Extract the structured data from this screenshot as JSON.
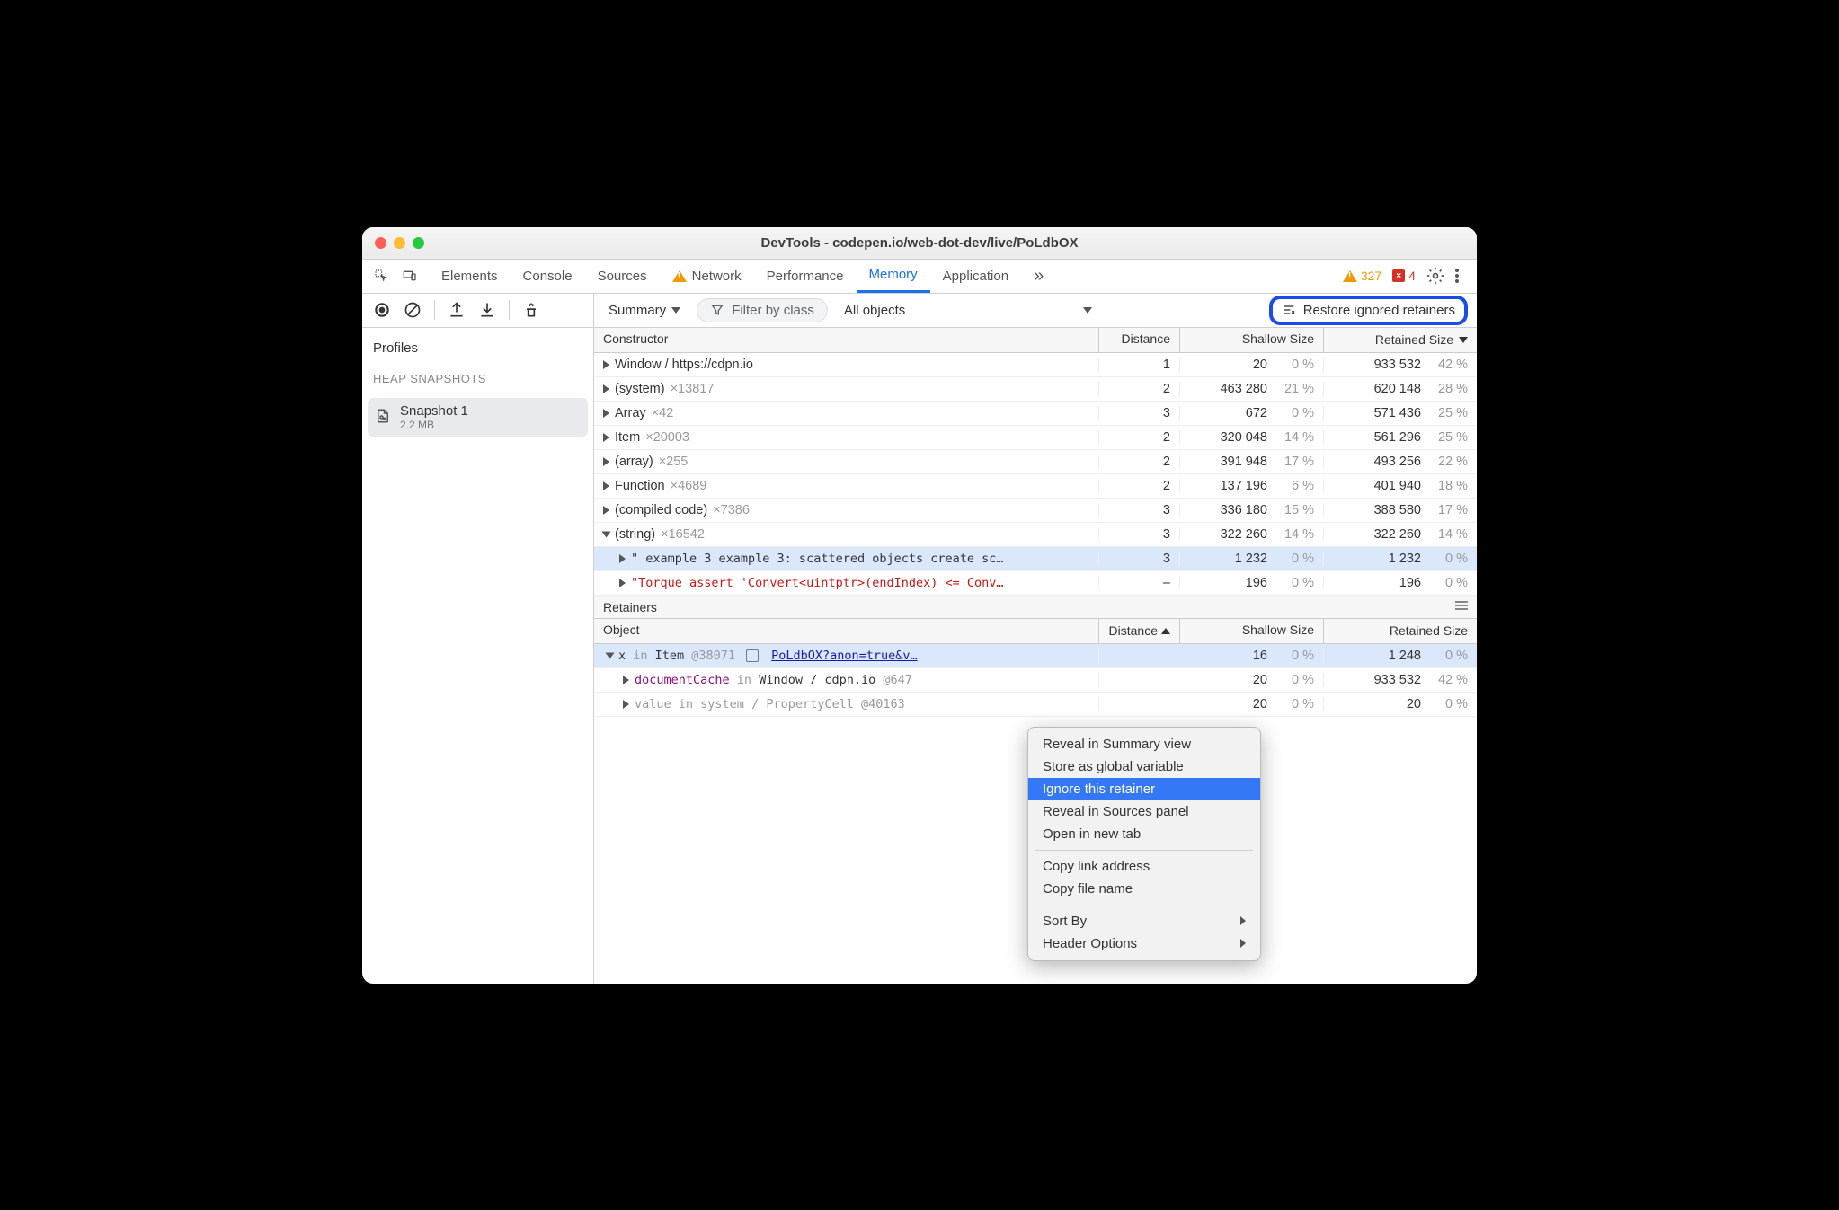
{
  "window": {
    "title": "DevTools - codepen.io/web-dot-dev/live/PoLdbOX"
  },
  "tabs": {
    "items": [
      "Elements",
      "Console",
      "Sources",
      "Network",
      "Performance",
      "Memory",
      "Application"
    ],
    "active": "Memory",
    "warn_count": "327",
    "err_count": "4"
  },
  "toolbar": {
    "summary": "Summary",
    "filter_placeholder": "Filter by class",
    "all_objects": "All objects",
    "restore": "Restore ignored retainers"
  },
  "sidebar": {
    "profiles": "Profiles",
    "section": "HEAP SNAPSHOTS",
    "snapshot": {
      "name": "Snapshot 1",
      "size": "2.2 MB"
    }
  },
  "headers": {
    "constructor": "Constructor",
    "distance": "Distance",
    "shallow": "Shallow Size",
    "retained": "Retained Size"
  },
  "rows": [
    {
      "c": "Window / https://cdpn.io",
      "x": "",
      "d": "1",
      "sv": "20",
      "sp": "0 %",
      "rv": "933 532",
      "rp": "42 %",
      "open": false,
      "indent": 0
    },
    {
      "c": "(system)",
      "x": "×13817",
      "d": "2",
      "sv": "463 280",
      "sp": "21 %",
      "rv": "620 148",
      "rp": "28 %",
      "open": false,
      "indent": 0
    },
    {
      "c": "Array",
      "x": "×42",
      "d": "3",
      "sv": "672",
      "sp": "0 %",
      "rv": "571 436",
      "rp": "25 %",
      "open": false,
      "indent": 0
    },
    {
      "c": "Item",
      "x": "×20003",
      "d": "2",
      "sv": "320 048",
      "sp": "14 %",
      "rv": "561 296",
      "rp": "25 %",
      "open": false,
      "indent": 0
    },
    {
      "c": "(array)",
      "x": "×255",
      "d": "2",
      "sv": "391 948",
      "sp": "17 %",
      "rv": "493 256",
      "rp": "22 %",
      "open": false,
      "indent": 0
    },
    {
      "c": "Function",
      "x": "×4689",
      "d": "2",
      "sv": "137 196",
      "sp": "6 %",
      "rv": "401 940",
      "rp": "18 %",
      "open": false,
      "indent": 0
    },
    {
      "c": "(compiled code)",
      "x": "×7386",
      "d": "3",
      "sv": "336 180",
      "sp": "15 %",
      "rv": "388 580",
      "rp": "17 %",
      "open": false,
      "indent": 0
    },
    {
      "c": "(string)",
      "x": "×16542",
      "d": "3",
      "sv": "322 260",
      "sp": "14 %",
      "rv": "322 260",
      "rp": "14 %",
      "open": true,
      "indent": 0
    },
    {
      "c": "\" example 3 example 3: scattered objects create sc…",
      "x": "",
      "d": "3",
      "sv": "1 232",
      "sp": "0 %",
      "rv": "1 232",
      "rp": "0 %",
      "open": false,
      "indent": 1,
      "mono": true,
      "sel": true
    },
    {
      "c": "\"Torque assert 'Convert<uintptr>(endIndex) <= Conv…",
      "x": "",
      "d": "–",
      "sv": "196",
      "sp": "0 %",
      "rv": "196",
      "rp": "0 %",
      "open": false,
      "indent": 1,
      "mono": true,
      "red": true
    }
  ],
  "retainers": {
    "label": "Retainers",
    "headers": {
      "object": "Object",
      "distance": "Distance",
      "shallow": "Shallow Size",
      "retained": "Retained Size"
    },
    "rows": [
      {
        "html": "x|in|Item|@38071",
        "link": "PoLdbOX?anon=true&v…",
        "d": "",
        "sv": "16",
        "sp": "0 %",
        "rv": "1 248",
        "rp": "0 %",
        "open": true,
        "sel": true,
        "indent": 0
      },
      {
        "html": "documentCache|in|Window / cdpn.io|@647",
        "d": "",
        "sv": "20",
        "sp": "0 %",
        "rv": "933 532",
        "rp": "42 %",
        "open": false,
        "indent": 1,
        "purple": true
      },
      {
        "html": "value|in|system / PropertyCell|@40163",
        "d": "",
        "sv": "20",
        "sp": "0 %",
        "rv": "20",
        "rp": "0 %",
        "open": false,
        "indent": 1,
        "dim": true
      }
    ]
  },
  "contextmenu": {
    "items": [
      {
        "t": "Reveal in Summary view"
      },
      {
        "t": "Store as global variable"
      },
      {
        "t": "Ignore this retainer",
        "hl": true
      },
      {
        "t": "Reveal in Sources panel"
      },
      {
        "t": "Open in new tab"
      },
      {
        "sep": true
      },
      {
        "t": "Copy link address"
      },
      {
        "t": "Copy file name"
      },
      {
        "sep": true
      },
      {
        "t": "Sort By",
        "sub": true
      },
      {
        "t": "Header Options",
        "sub": true
      }
    ]
  }
}
